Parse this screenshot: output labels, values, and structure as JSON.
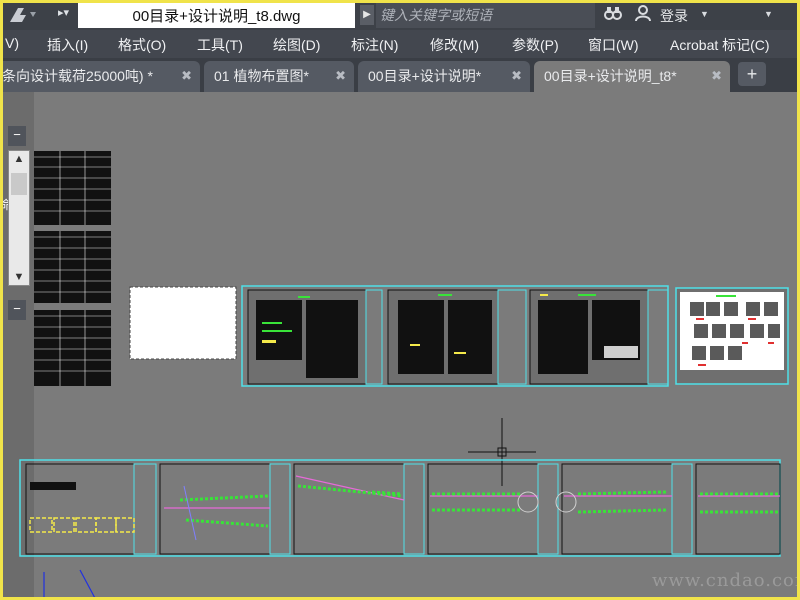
{
  "titlebar": {
    "document_title": "00目录+设计说明_t8.dwg",
    "search_placeholder": "键入关键字或短语",
    "login_label": "登录",
    "icons": [
      "app-logo-icon",
      "binoculars-icon",
      "user-icon",
      "dropdown-caret-icon"
    ]
  },
  "menu": {
    "items": [
      "V)",
      "插入(I)",
      "格式(O)",
      "工具(T)",
      "绘图(D)",
      "标注(N)",
      "修改(M)",
      "参数(P)",
      "窗口(W)",
      "Acrobat 标记(C)"
    ]
  },
  "tabs": [
    {
      "label": "条向设计载荷25000吨)  *",
      "active": false
    },
    {
      "label": "01 植物布置图*",
      "active": false
    },
    {
      "label": "00目录+设计说明*",
      "active": false
    },
    {
      "label": "00目录+设计说明_t8*",
      "active": true
    }
  ],
  "new_tab_label": "+",
  "panel": {
    "collapse_label": "−",
    "side_label": "命"
  },
  "watermark": "www.cndao.com",
  "colors": {
    "canvas": "#7b7b7b",
    "frame_cyan": "#4fe0e8",
    "accent_green": "#39e339",
    "highlight_yellow": "#f4e94a",
    "title_bar": "#3d4148"
  }
}
